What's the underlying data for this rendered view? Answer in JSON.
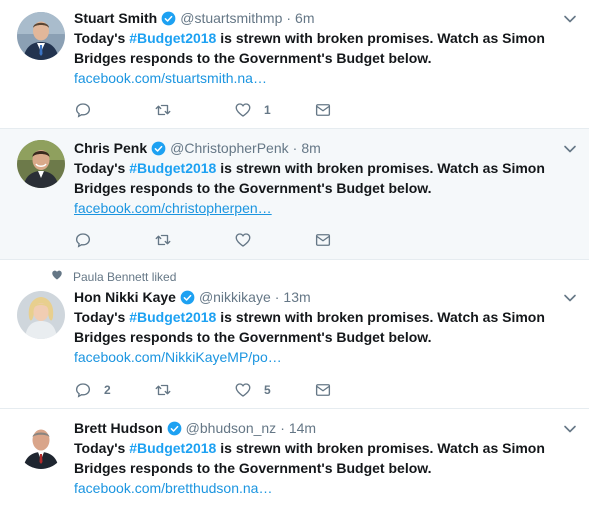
{
  "tweets": [
    {
      "social_context": "",
      "name": "Stuart Smith",
      "handle": "@stuartsmithmp",
      "time": "6m",
      "text_a": "Today's ",
      "hashtag": "#Budget2018",
      "text_b": " is strewn with broken promises. Watch as Simon Bridges responds to the Government's Budget below.",
      "link": "facebook.com/stuartsmith.na…",
      "reply_count": "",
      "retweet_count": "",
      "like_count": "1"
    },
    {
      "social_context": "",
      "name": "Chris Penk",
      "handle": "@ChristopherPenk",
      "time": "8m",
      "text_a": "Today's ",
      "hashtag": "#Budget2018",
      "text_b": " is strewn with broken promises. Watch as Simon Bridges responds to the Government's Budget below.",
      "link": "facebook.com/christopherpen…",
      "reply_count": "",
      "retweet_count": "",
      "like_count": ""
    },
    {
      "social_context": "Paula Bennett liked",
      "name": "Hon Nikki Kaye",
      "handle": "@nikkikaye",
      "time": "13m",
      "text_a": "Today's ",
      "hashtag": "#Budget2018",
      "text_b": " is strewn with broken promises. Watch as Simon Bridges responds to the Government's Budget below.",
      "link": "facebook.com/NikkiKayeMP/po…",
      "reply_count": "2",
      "retweet_count": "",
      "like_count": "5"
    },
    {
      "social_context": "",
      "name": "Brett Hudson",
      "handle": "@bhudson_nz",
      "time": "14m",
      "text_a": "Today's ",
      "hashtag": "#Budget2018",
      "text_b": " is strewn with broken promises. Watch as Simon Bridges responds to the Government's Budget below.",
      "link": "facebook.com/bretthudson.na…",
      "reply_count": "",
      "retweet_count": "",
      "like_count": ""
    }
  ],
  "separator": "·",
  "icons": {
    "reply": "reply-icon",
    "retweet": "retweet-icon",
    "like": "heart-icon",
    "dm": "direct-message-icon",
    "caret": "chevron-down-icon",
    "verified": "verified-badge-icon",
    "liked": "heart-icon"
  },
  "colors": {
    "link": "#1b95e0",
    "hashtag": "#1da1f2",
    "verified": "#1da1f2",
    "muted": "#657786",
    "highlight_bg": "#f5f8fa"
  }
}
